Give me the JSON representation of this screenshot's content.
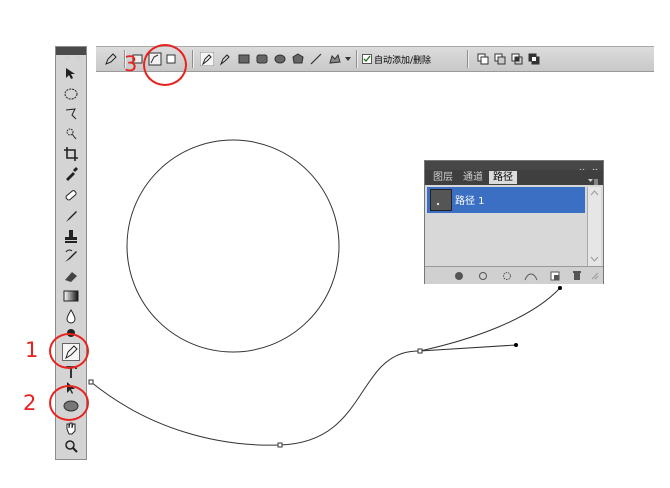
{
  "options_bar": {
    "auto_add_delete_label": "自动添加/删除",
    "auto_add_delete_checked": true,
    "tools": [
      "pen-tool-icon",
      "shape-layers-icon",
      "paths-icon",
      "fill-pixels-icon",
      "pen-icon",
      "freeform-pen-icon",
      "rectangle-icon",
      "rounded-rectangle-icon",
      "ellipse-icon",
      "polygon-icon",
      "line-icon",
      "custom-shape-icon",
      "add-to-path-area-icon",
      "subtract-from-path-area-icon",
      "intersect-path-areas-icon",
      "exclude-overlapping-path-areas-icon"
    ]
  },
  "toolbox": {
    "tools": [
      "move-tool-icon",
      "marquee-tool-icon",
      "lasso-tool-icon",
      "quick-selection-tool-icon",
      "crop-tool-icon",
      "eyedropper-tool-icon",
      "spot-healing-tool-icon",
      "brush-tool-icon",
      "clone-stamp-tool-icon",
      "history-brush-tool-icon",
      "eraser-tool-icon",
      "gradient-tool-icon",
      "blur-tool-icon",
      "dodge-tool-icon",
      "pen-tool-icon",
      "type-tool-icon",
      "path-selection-tool-icon",
      "ellipse-tool-icon",
      "hand-tool-icon",
      "zoom-tool-icon"
    ]
  },
  "paths_panel": {
    "tabs": [
      "图层",
      "通道",
      "路径"
    ],
    "active_tab": "路径",
    "path_item": "路径 1",
    "selection_color": "#3a6fc4"
  },
  "annotations": {
    "labels": [
      "1",
      "2",
      "3"
    ],
    "color": "#e8231f"
  }
}
